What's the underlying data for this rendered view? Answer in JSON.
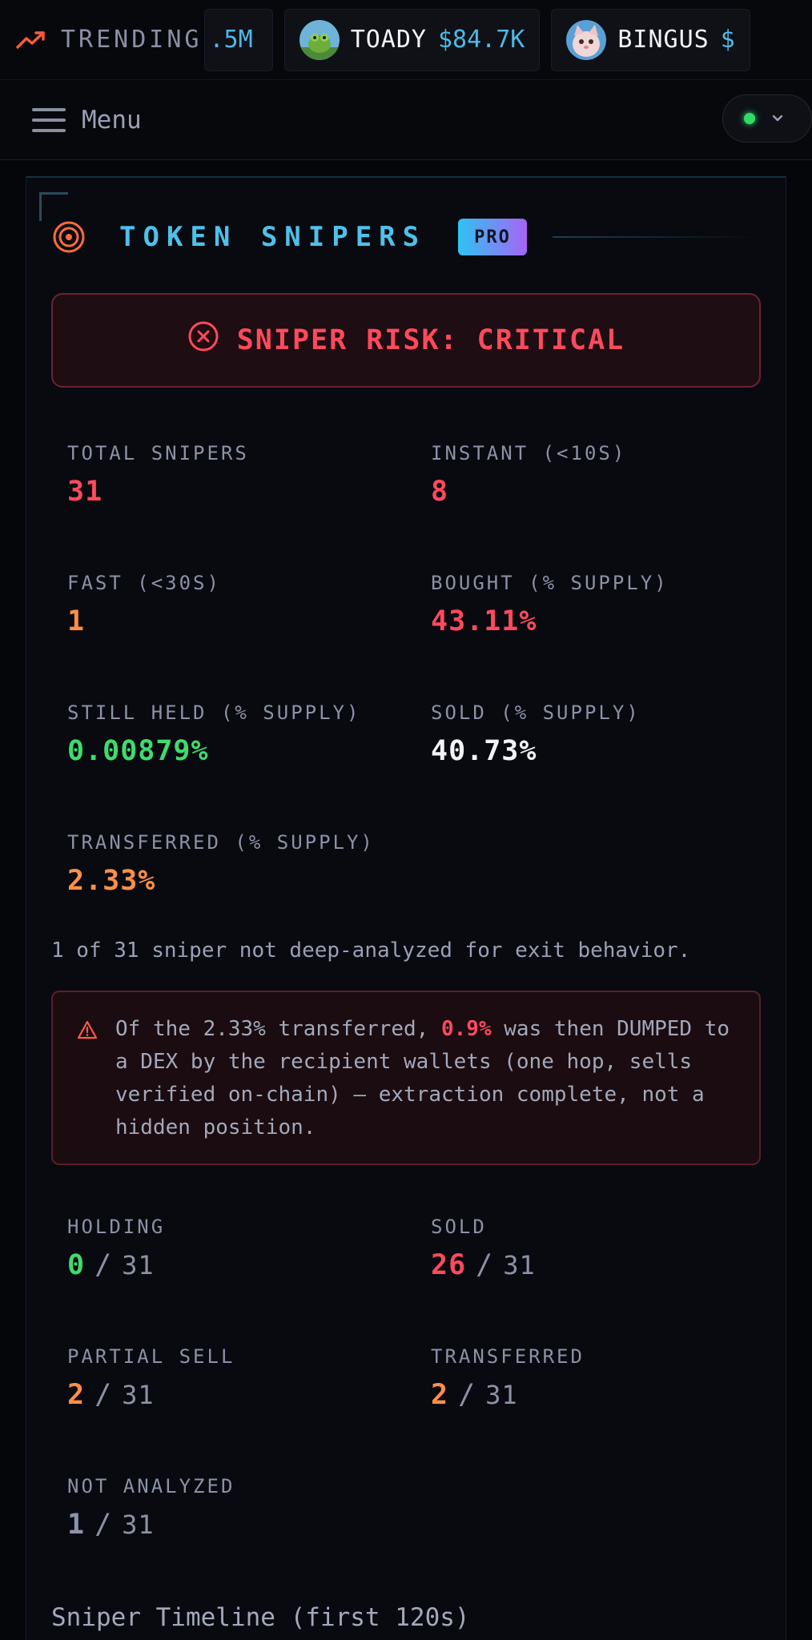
{
  "ticker": {
    "label": "TRENDING",
    "first_item_price": ".5M",
    "items": [
      {
        "name": "TOADY",
        "price": "$84.7K"
      },
      {
        "name": "BINGUS",
        "price": "$"
      }
    ],
    "colors": {
      "trend_icon": "#ff5a3c",
      "price": "#4fb8e6"
    }
  },
  "menubar": {
    "menu_label": "Menu",
    "status_color": "#2fdc6a"
  },
  "panel": {
    "title": "TOKEN SNIPERS",
    "badge": "PRO",
    "risk": {
      "text": "SNIPER RISK: CRITICAL",
      "color": "#ff4a5c"
    },
    "stats": [
      {
        "label": "TOTAL SNIPERS",
        "value": "31",
        "color": "red"
      },
      {
        "label": "INSTANT (<10S)",
        "value": "8",
        "color": "red"
      },
      {
        "label": "FAST (<30S)",
        "value": "1",
        "color": "orange"
      },
      {
        "label": "BOUGHT (% SUPPLY)",
        "value": "43.11%",
        "color": "red"
      },
      {
        "label": "STILL HELD (% SUPPLY)",
        "value": "0.00879%",
        "color": "green"
      },
      {
        "label": "SOLD (% SUPPLY)",
        "value": "40.73%",
        "color": "white"
      },
      {
        "label": "TRANSFERRED (% SUPPLY)",
        "value": "2.33%",
        "color": "orange"
      }
    ],
    "note": "1 of 31 sniper not deep-analyzed for exit behavior.",
    "warning": {
      "before": "Of the 2.33% transferred, ",
      "highlight": "0.9%",
      "after": " was then DUMPED to a DEX by the recipient wallets (one hop, sells verified on-chain) — extraction complete, not a hidden position."
    },
    "exit_stats": [
      {
        "label": "HOLDING",
        "value": "0",
        "separator": "/",
        "total": "31",
        "color": "green"
      },
      {
        "label": "SOLD",
        "value": "26",
        "separator": "/",
        "total": "31",
        "color": "red"
      },
      {
        "label": "PARTIAL SELL",
        "value": "2",
        "separator": "/",
        "total": "31",
        "color": "orange"
      },
      {
        "label": "TRANSFERRED",
        "value": "2",
        "separator": "/",
        "total": "31",
        "color": "orange"
      },
      {
        "label": "NOT ANALYZED",
        "value": "1",
        "separator": "/",
        "total": "31",
        "color": "slate"
      }
    ],
    "timeline_title": "Sniper Timeline (first 120s)"
  }
}
